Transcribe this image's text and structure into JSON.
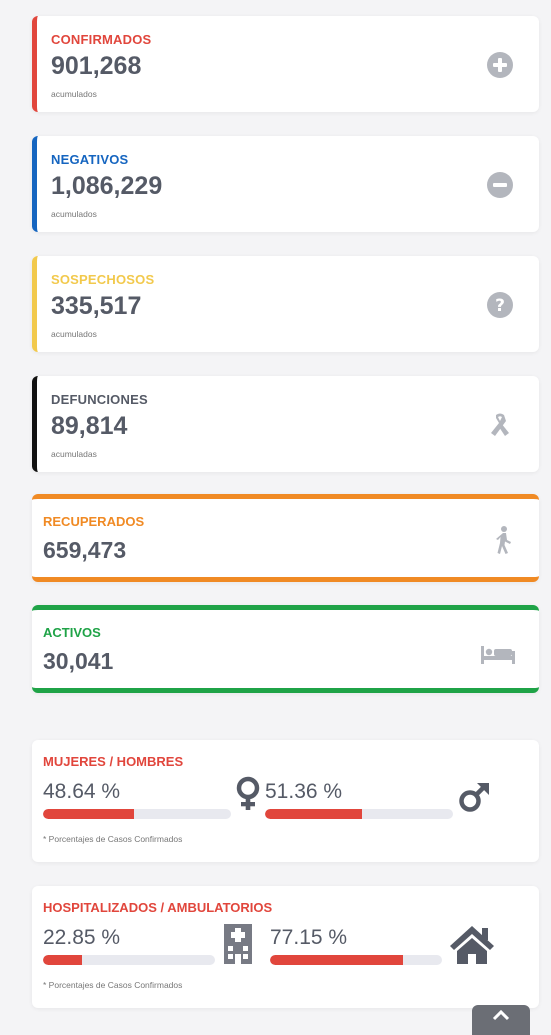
{
  "cards": [
    {
      "label": "CONFIRMADOS",
      "value": "901,268",
      "sub": "acumulados",
      "color": "#e1463c",
      "icon": "plus-circle-icon"
    },
    {
      "label": "NEGATIVOS",
      "value": "1,086,229",
      "sub": "acumulados",
      "color": "#1565c0",
      "icon": "minus-circle-icon"
    },
    {
      "label": "SOSPECHOSOS",
      "value": "335,517",
      "sub": "acumulados",
      "color": "#f2c94c",
      "icon": "question-circle-icon"
    },
    {
      "label": "DEFUNCIONES",
      "value": "89,814",
      "sub": "acumuladas",
      "color": "#111111",
      "icon": "ribbon-icon"
    }
  ],
  "recuperados": {
    "label": "RECUPERADOS",
    "value": "659,473",
    "color": "#f08a24",
    "icon": "walking-person-icon"
  },
  "activos": {
    "label": "ACTIVOS",
    "value": "30,041",
    "color": "#1fa347",
    "icon": "bed-icon"
  },
  "mujeres_hombres": {
    "label": "MUJERES / HOMBRES",
    "left_pct": "48.64 %",
    "left_value": 48.64,
    "right_pct": "51.36 %",
    "right_value": 51.36,
    "note": "* Porcentajes  de Casos Confirmados",
    "left_icon": "female-symbol-icon",
    "right_icon": "male-symbol-icon"
  },
  "hospitalizados": {
    "label": "HOSPITALIZADOS / AMBULATORIOS",
    "left_pct": "22.85 %",
    "left_value": 22.85,
    "right_pct": "77.15 %",
    "right_value": 77.15,
    "note": "* Porcentajes  de Casos Confirmados",
    "left_icon": "hospital-icon",
    "right_icon": "house-icon"
  },
  "colors": {
    "accent_red": "#e1463c",
    "text_dark": "#555a66",
    "icon_gray": "#b3b6bd"
  },
  "scroll_top_icon": "chevron-up-icon"
}
